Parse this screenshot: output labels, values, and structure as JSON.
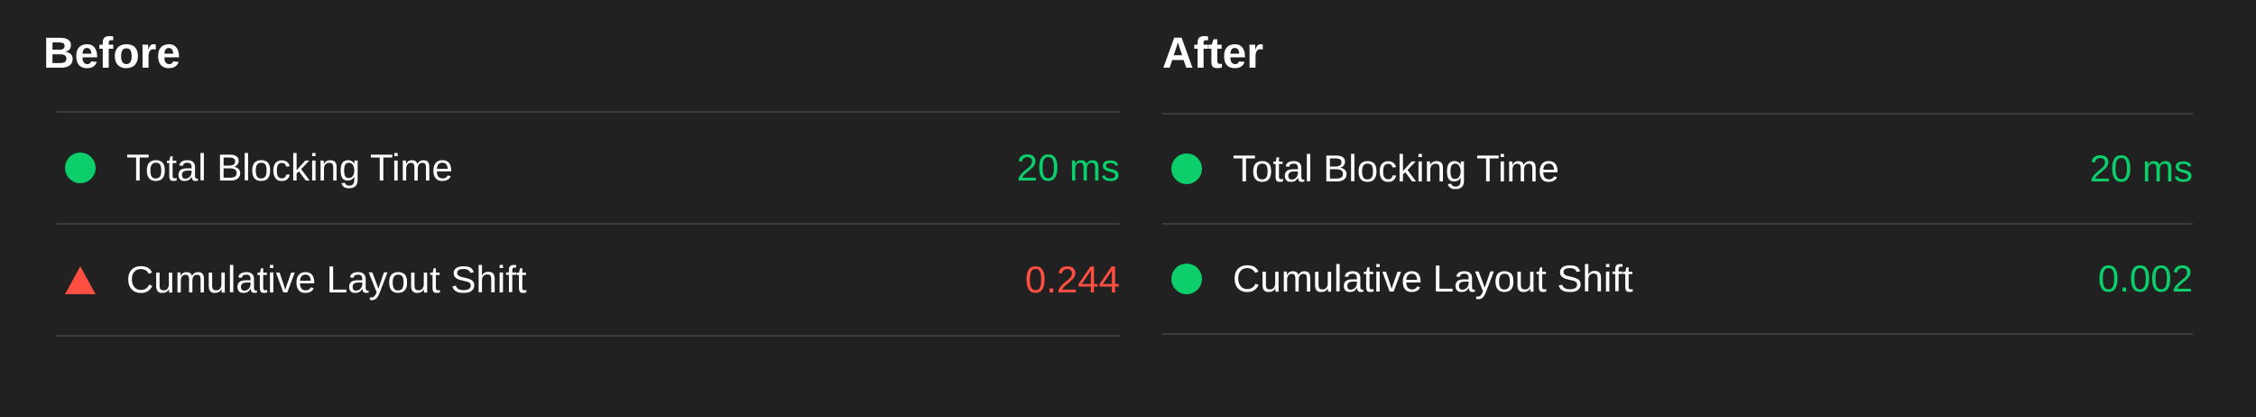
{
  "colors": {
    "background": "#212121",
    "pass": "#0cce6b",
    "fail": "#ff4e42",
    "divider": "#3c3c3c",
    "text": "#ffffff"
  },
  "before": {
    "title": "Before",
    "metrics": [
      {
        "icon": "green-circle-icon",
        "status": "pass",
        "label": "Total Blocking Time",
        "value": "20 ms"
      },
      {
        "icon": "red-triangle-icon",
        "status": "fail",
        "label": "Cumulative Layout Shift",
        "value": "0.244"
      }
    ]
  },
  "after": {
    "title": "After",
    "metrics": [
      {
        "icon": "green-circle-icon",
        "status": "pass",
        "label": "Total Blocking Time",
        "value": "20 ms"
      },
      {
        "icon": "green-circle-icon",
        "status": "pass",
        "label": "Cumulative Layout Shift",
        "value": "0.002"
      }
    ]
  }
}
